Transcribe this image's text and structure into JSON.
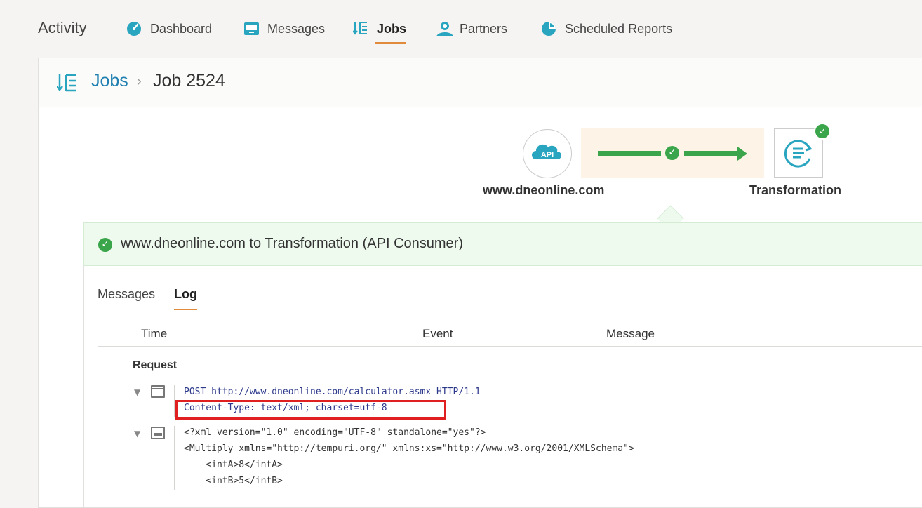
{
  "nav": {
    "brand": "Activity",
    "items": [
      {
        "label": "Dashboard",
        "icon": "gauge-icon",
        "active": false
      },
      {
        "label": "Messages",
        "icon": "inbox-icon",
        "active": false
      },
      {
        "label": "Jobs",
        "icon": "jobs-icon",
        "active": true
      },
      {
        "label": "Partners",
        "icon": "partners-icon",
        "active": false
      },
      {
        "label": "Scheduled Reports",
        "icon": "pie-chart-icon",
        "active": false
      }
    ]
  },
  "breadcrumb": {
    "parent": "Jobs",
    "separator": "›",
    "current": "Job 2524"
  },
  "flow": {
    "source_badge": "API",
    "source_label": "www.dneonline.com",
    "target_label": "Transformation",
    "status": "success"
  },
  "step": {
    "title": "www.dneonline.com to Transformation (API Consumer)"
  },
  "tabs": [
    {
      "label": "Messages",
      "active": false
    },
    {
      "label": "Log",
      "active": true
    }
  ],
  "table": {
    "columns": [
      "Time",
      "Event",
      "Message"
    ],
    "group": "Request",
    "headers_block": {
      "request_line": "POST http://www.dneonline.com/calculator.asmx HTTP/1.1",
      "content_type": "Content-Type: text/xml; charset=utf-8"
    },
    "body_block": {
      "lines": [
        "<?xml version=\"1.0\" encoding=\"UTF-8\" standalone=\"yes\"?>",
        "<Multiply xmlns=\"http://tempuri.org/\" xmlns:xs=\"http://www.w3.org/2001/XMLSchema\">",
        "    <intA>8</intA>",
        "    <intB>5</intB>"
      ]
    }
  },
  "colors": {
    "accent": "#e08a3c",
    "link": "#1e7fb0",
    "success": "#3aa54a",
    "icon_teal": "#2aa5c0",
    "highlight": "#e02020"
  }
}
